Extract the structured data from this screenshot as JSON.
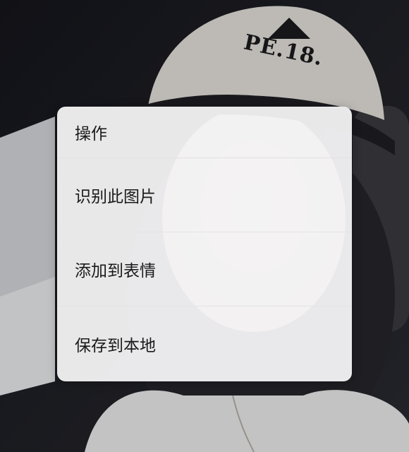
{
  "photo": {
    "cap_text": "PE.18."
  },
  "menu": {
    "title": "操作",
    "items": [
      {
        "label": "识别此图片"
      },
      {
        "label": "添加到表情"
      },
      {
        "label": "保存到本地"
      }
    ]
  }
}
